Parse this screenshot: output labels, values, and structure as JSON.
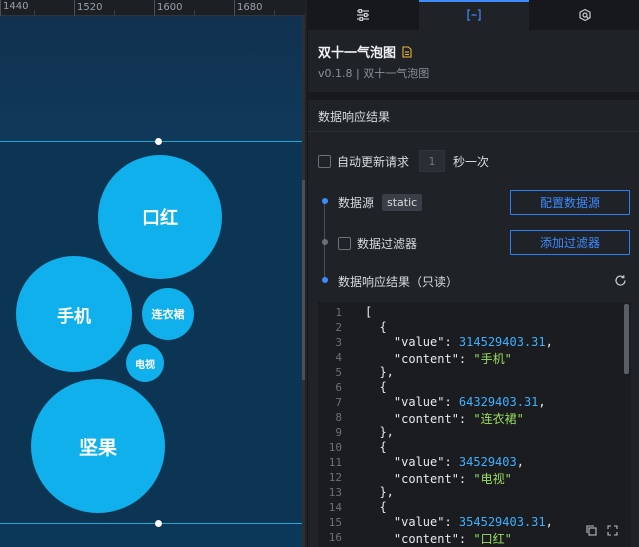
{
  "ruler": {
    "ticks": [
      "1440",
      "1520",
      "1600",
      "1680"
    ]
  },
  "bubbles": [
    {
      "label": "口红"
    },
    {
      "label": "手机"
    },
    {
      "label": "连衣裙"
    },
    {
      "label": "电视"
    },
    {
      "label": "坚果"
    }
  ],
  "tabs": [
    {
      "icon": "sliders-icon"
    },
    {
      "icon": "data-bracket-icon"
    },
    {
      "icon": "interaction-icon"
    }
  ],
  "component": {
    "title": "双十一气泡图",
    "version": "v0.1.8 | 双十一气泡图"
  },
  "section": {
    "title": "数据响应结果"
  },
  "auto_update": {
    "label": "自动更新请求",
    "interval": "1",
    "unit": "秒一次"
  },
  "source": {
    "label": "数据源",
    "type": "static",
    "button": "配置数据源"
  },
  "filter": {
    "label": "数据过滤器",
    "button": "添加过滤器"
  },
  "result": {
    "label": "数据响应结果（只读）"
  },
  "colors": {
    "accent": "#3d8bff",
    "bubble": "#0fb0ec",
    "json_number": "#3fb0ff",
    "json_string": "#9bde5b"
  },
  "code": {
    "line_numbers": [
      "1",
      "2",
      "3",
      "4",
      "5",
      "6",
      "7",
      "8",
      "9",
      "10",
      "11",
      "12",
      "13",
      "14",
      "15",
      "16"
    ],
    "lines": [
      {
        "t": "["
      },
      {
        "t": "  {"
      },
      {
        "t": "    \"value\": ",
        "num": "314529403.31",
        "tail": ","
      },
      {
        "t": "    \"content\": ",
        "str": "\"手机\""
      },
      {
        "t": "  },"
      },
      {
        "t": "  {"
      },
      {
        "t": "    \"value\": ",
        "num": "64329403.31",
        "tail": ","
      },
      {
        "t": "    \"content\": ",
        "str": "\"连衣裙\""
      },
      {
        "t": "  },"
      },
      {
        "t": "  {"
      },
      {
        "t": "    \"value\": ",
        "num": "34529403",
        "tail": ","
      },
      {
        "t": "    \"content\": ",
        "str": "\"电视\""
      },
      {
        "t": "  },"
      },
      {
        "t": "  {"
      },
      {
        "t": "    \"value\": ",
        "num": "354529403.31",
        "tail": ","
      },
      {
        "t": "    \"content\": ",
        "str": "\"口红\""
      }
    ]
  }
}
